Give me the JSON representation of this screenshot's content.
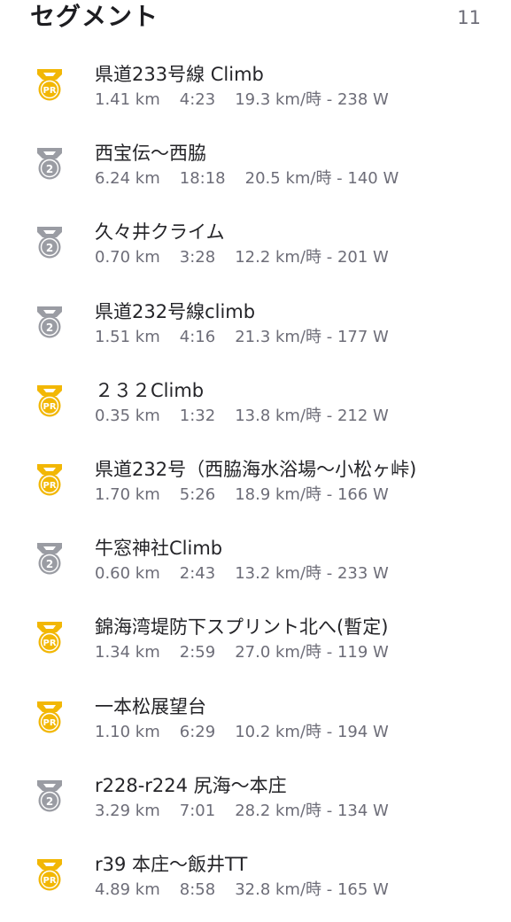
{
  "header": {
    "title": "セグメント",
    "count": "11"
  },
  "colors": {
    "pr_gold": "#F2B705",
    "silver": "#9A9CA3",
    "text_primary": "#242428",
    "text_secondary": "#6D6D78"
  },
  "segments": [
    {
      "name": "県道233号線 Climb",
      "badge": "PR",
      "badge_icon": "pr-medal-icon",
      "distance": "1.41 km",
      "time": "4:23",
      "speed_power": "19.3 km/時 - 238 W"
    },
    {
      "name": "西宝伝〜西脇",
      "badge": "2",
      "badge_icon": "second-place-medal-icon",
      "distance": "6.24 km",
      "time": "18:18",
      "speed_power": "20.5 km/時 - 140 W"
    },
    {
      "name": "久々井クライム",
      "badge": "2",
      "badge_icon": "second-place-medal-icon",
      "distance": "0.70 km",
      "time": "3:28",
      "speed_power": "12.2 km/時 - 201 W"
    },
    {
      "name": "県道232号線climb",
      "badge": "2",
      "badge_icon": "second-place-medal-icon",
      "distance": "1.51 km",
      "time": "4:16",
      "speed_power": "21.3 km/時 - 177 W"
    },
    {
      "name": "２３２Climb",
      "badge": "PR",
      "badge_icon": "pr-medal-icon",
      "distance": "0.35 km",
      "time": "1:32",
      "speed_power": "13.8 km/時 - 212 W"
    },
    {
      "name": "県道232号（西脇海水浴場〜小松ヶ峠)",
      "badge": "PR",
      "badge_icon": "pr-medal-icon",
      "distance": "1.70 km",
      "time": "5:26",
      "speed_power": "18.9 km/時 - 166 W"
    },
    {
      "name": "牛窓神社Climb",
      "badge": "2",
      "badge_icon": "second-place-medal-icon",
      "distance": "0.60 km",
      "time": "2:43",
      "speed_power": "13.2 km/時 - 233 W"
    },
    {
      "name": "錦海湾堤防下スプリント北へ(暫定)",
      "badge": "PR",
      "badge_icon": "pr-medal-icon",
      "distance": "1.34 km",
      "time": "2:59",
      "speed_power": "27.0 km/時 - 119 W"
    },
    {
      "name": "一本松展望台",
      "badge": "PR",
      "badge_icon": "pr-medal-icon",
      "distance": "1.10 km",
      "time": "6:29",
      "speed_power": "10.2 km/時 - 194 W"
    },
    {
      "name": "r228-r224 尻海〜本庄",
      "badge": "2",
      "badge_icon": "second-place-medal-icon",
      "distance": "3.29 km",
      "time": "7:01",
      "speed_power": "28.2 km/時 - 134 W"
    },
    {
      "name": "r39 本庄〜飯井TT",
      "badge": "PR",
      "badge_icon": "pr-medal-icon",
      "distance": "4.89 km",
      "time": "8:58",
      "speed_power": "32.8 km/時 - 165 W"
    }
  ]
}
